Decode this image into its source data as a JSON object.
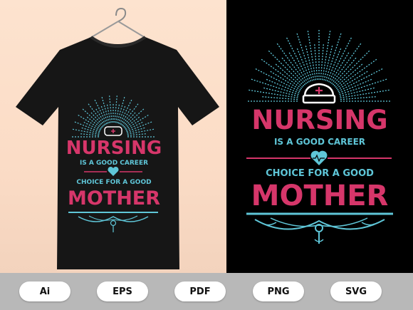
{
  "design": {
    "line1": "NURSING",
    "line2": "IS A GOOD CAREER",
    "line3": "CHOICE FOR A GOOD",
    "line4": "MOTHER"
  },
  "formats": [
    "Ai",
    "EPS",
    "PDF",
    "PNG",
    "SVG"
  ],
  "colors": {
    "pink": "#d6366a",
    "cyan": "#5fc6d8",
    "shirt": "#141414",
    "left_bg": "#fde3cf",
    "right_bg": "#000000",
    "bar": "#b8b8b8"
  },
  "icons": [
    "hanger-icon",
    "nurse-cap-icon",
    "heartbeat-heart-icon",
    "ornament-divider-icon",
    "sunburst-icon"
  ]
}
